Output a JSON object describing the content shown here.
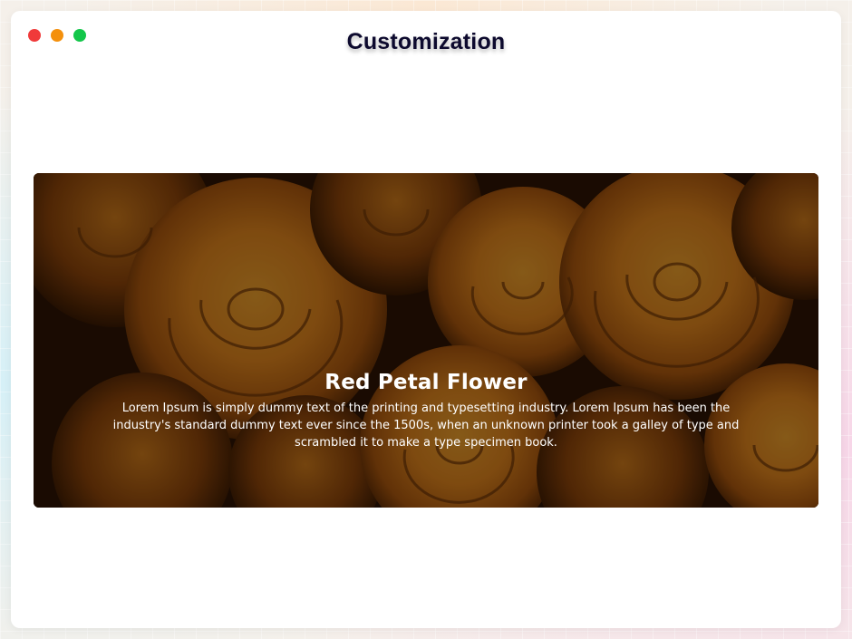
{
  "window": {
    "controls": [
      {
        "name": "close",
        "color": "#f03a3a"
      },
      {
        "name": "minimize",
        "color": "#f4900c"
      },
      {
        "name": "maximize",
        "color": "#13c64a"
      }
    ]
  },
  "header": {
    "title": "Customization"
  },
  "banner": {
    "image": "orange-roses-photo",
    "title": "Red Petal Flower",
    "description": "Lorem Ipsum is simply dummy text of the printing and typesetting industry. Lorem Ipsum has been the industry's standard dummy text ever since the 1500s, when an unknown printer took a galley of type and scrambled it to make a type specimen book."
  }
}
